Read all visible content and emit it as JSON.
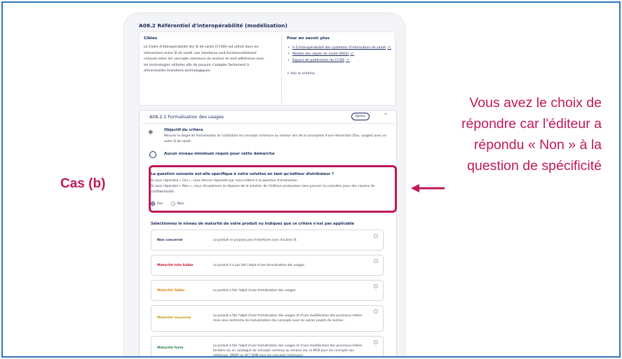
{
  "section": {
    "title": "A08.2 Référentiel d'interopérabilité (modélisation)",
    "cibles_title": "Cibles",
    "cibles_text": "Le Cadre d'Interopérabilité des SI de santé (CI-SIS) est utilisé dans les interactions entre SI de santé. Les interfaces sont fonctionnellement conçues selon les concepts communs du secteur et sont adhérence avec les technologies utilisées afin de pouvoir s'adapter facilement à d'éventuelles évolutions technologiques.",
    "more_title": "Pour en savoir plus",
    "links": [
      "II-3 Interopérabilité des systèmes d'information de santé",
      "Modèle des objets de santé (MOS)",
      "Espace de publication du CI-SIS"
    ],
    "link_suffixes": [
      ";",
      ";",
      "."
    ],
    "voir_schema": "+ Voir le schéma"
  },
  "criterion": {
    "title": "A08.2.1 Formalisation des usages",
    "option_badge": "Option",
    "objective_title": "Objectif du critère",
    "objective_text": "Mesurer le degré de formalisation et l'utilisation de concepts communs au secteur lors de la conception d'une interaction (flux, usages) avec un autre SI de santé.",
    "min_level_text": "Aucun niveau minimum requis pour cette démarche",
    "question_title": "La question suivante est-elle spécifique à votre solution en tant qu'éditeur distributeur ?",
    "question_line1": "Si vous répondez « Oui », vous devrez répondre par vous-même à la question d'évaluation.",
    "question_line2": "Si vous répondez « Non », vous récupérerez la réponse de la solution de l'éditeur producteur sans pouvoir la consulter pour des raisons de confidentialité.",
    "answer_yes": "Oui",
    "answer_no": "Non",
    "selected_answer": "Oui",
    "levels_title": "Sélectionnez le niveau de maturité de votre produit ou indiquez que ce critère n'est pas applicable",
    "levels": [
      {
        "name": "Non concerné",
        "desc": "Le produit ne propose pas d'interfaces avec d'autres SI.",
        "color": "#1b2a5c"
      },
      {
        "name": "Maturité très faible",
        "desc": "Le produit n'a pas fait l'objet d'une formalisation des usages.",
        "color": "#c8102e"
      },
      {
        "name": "Maturité faible",
        "desc": "Le produit a fait l'objet d'une formalisation des usages.",
        "color": "#e07b00"
      },
      {
        "name": "Maturité moyenne",
        "desc": "Le produit a fait l'objet d'une formalisation des usages et d'une modélisation des processus métier mais sans recherche de mutualisation des concepts avec les autres projets du secteur.",
        "color": "#b89a00"
      },
      {
        "name": "Maturité forte",
        "desc": "Le produit a fait l'objet d'une formalisation des usages et d'une modélisation des processus métier fondées sur un catalogue de concepts commun au secteur (ex. le MOS pour les concepts non médicaux, OMOP ou HL7 DAM pour les concepts médicaux).",
        "color": "#1e7a3c"
      }
    ]
  },
  "annotation": {
    "case_label": "Cas (b)",
    "note": "Vous avez le choix de répondre car l'éditeur a répondu « Non » à la question de spécificité",
    "accent_color": "#c0185a"
  }
}
